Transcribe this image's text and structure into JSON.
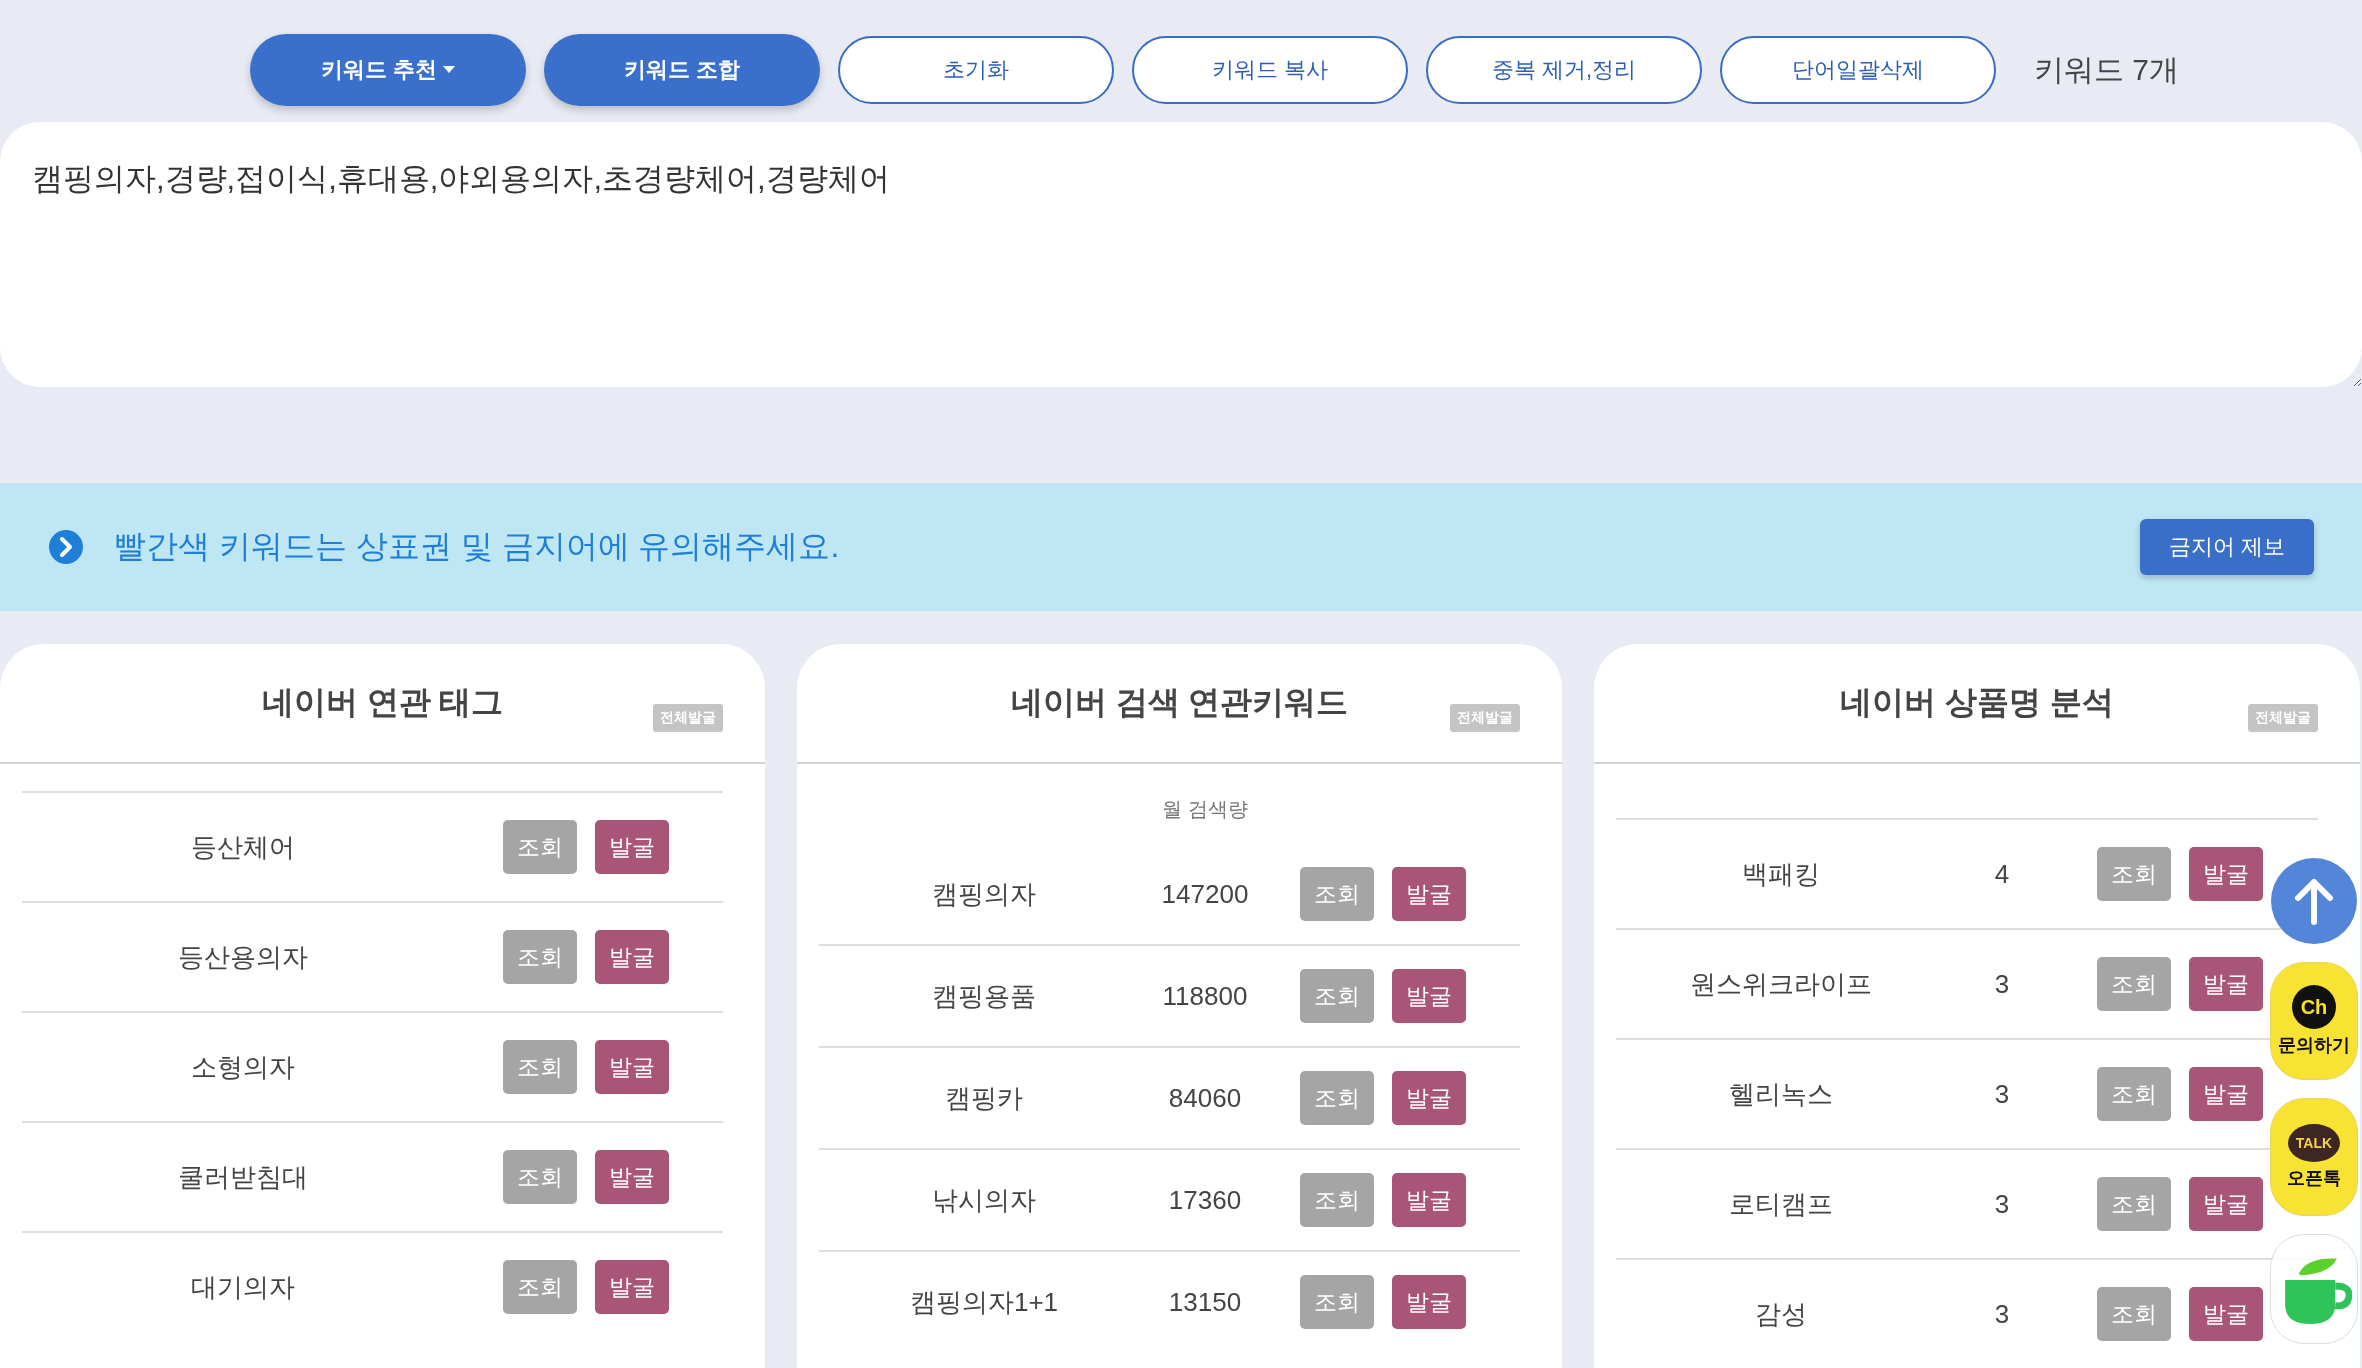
{
  "toolbar": {
    "buttons": [
      {
        "label": "키워드 추천",
        "kind": "dropdown"
      },
      {
        "label": "키워드 조합",
        "kind": "primary"
      },
      {
        "label": "초기화",
        "kind": "outline"
      },
      {
        "label": "키워드 복사",
        "kind": "outline"
      },
      {
        "label": "중복 제거,정리",
        "kind": "outline"
      },
      {
        "label": "단어일괄삭제",
        "kind": "outline"
      }
    ],
    "count": "키워드 7개"
  },
  "keyword_input": {
    "value": "캠핑의자,경량,접이식,휴대용,야외용의자,초경량체어,경량체어"
  },
  "notice": {
    "text": "빨간색 키워드는 상표권 및 금지어에 유의해주세요.",
    "button": "금지어 제보"
  },
  "panels": [
    {
      "title": "네이버 연관 태그",
      "all_button": "전체발굴",
      "rows": [
        {
          "keyword": "등산체어",
          "view": "조회",
          "dig": "발굴"
        },
        {
          "keyword": "등산용의자",
          "view": "조회",
          "dig": "발굴"
        },
        {
          "keyword": "소형의자",
          "view": "조회",
          "dig": "발굴"
        },
        {
          "keyword": "쿨러받침대",
          "view": "조회",
          "dig": "발굴"
        },
        {
          "keyword": "대기의자",
          "view": "조회",
          "dig": "발굴"
        }
      ]
    },
    {
      "title": "네이버 검색 연관키워드",
      "all_button": "전체발굴",
      "column_header": "월 검색량",
      "rows": [
        {
          "keyword": "캠핑의자",
          "count": "147200",
          "view": "조회",
          "dig": "발굴"
        },
        {
          "keyword": "캠핑용품",
          "count": "118800",
          "view": "조회",
          "dig": "발굴"
        },
        {
          "keyword": "캠핑카",
          "count": "84060",
          "view": "조회",
          "dig": "발굴"
        },
        {
          "keyword": "낚시의자",
          "count": "17360",
          "view": "조회",
          "dig": "발굴"
        },
        {
          "keyword": "캠핑의자1+1",
          "count": "13150",
          "view": "조회",
          "dig": "발굴"
        }
      ]
    },
    {
      "title": "네이버 상품명 분석",
      "all_button": "전체발굴",
      "rows": [
        {
          "keyword": "백패킹",
          "count": "4",
          "view": "조회",
          "dig": "발굴"
        },
        {
          "keyword": "원스위크라이프",
          "count": "3",
          "view": "조회",
          "dig": "발굴"
        },
        {
          "keyword": "헬리녹스",
          "count": "3",
          "view": "조회",
          "dig": "발굴"
        },
        {
          "keyword": "로티캠프",
          "count": "3",
          "view": "조회",
          "dig": "발굴"
        },
        {
          "keyword": "감성",
          "count": "3",
          "view": "조회",
          "dig": "발굴"
        }
      ]
    }
  ],
  "floating": [
    {
      "kind": "top"
    },
    {
      "kind": "chat",
      "badge": "Ch",
      "label": "문의하기"
    },
    {
      "kind": "talk",
      "badge": "TALK",
      "label": "오픈톡"
    },
    {
      "kind": "cup"
    }
  ]
}
